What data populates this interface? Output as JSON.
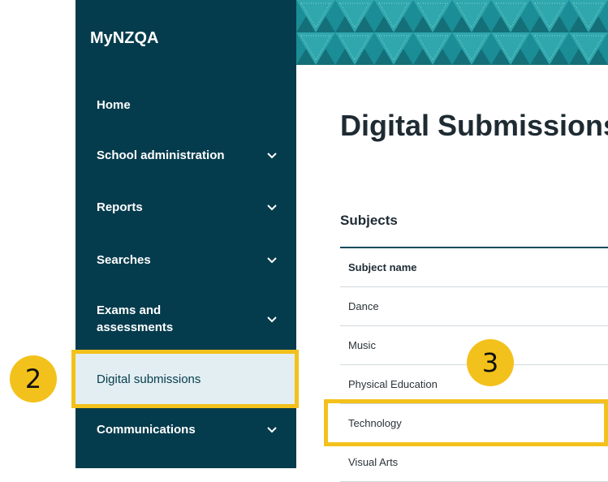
{
  "app": {
    "brand": "MyNZQA"
  },
  "sidebar": {
    "items": [
      {
        "label": "Home",
        "expandable": false
      },
      {
        "label": "School administration",
        "expandable": true
      },
      {
        "label": "Reports",
        "expandable": true
      },
      {
        "label": "Searches",
        "expandable": true
      },
      {
        "label": "Exams and assessments",
        "expandable": true
      },
      {
        "label": "Digital submissions",
        "expandable": false,
        "active": true
      },
      {
        "label": "Communications",
        "expandable": true
      }
    ]
  },
  "main": {
    "title": "Digital Submissions",
    "section_title": "Subjects",
    "table": {
      "header": "Subject name",
      "rows": [
        "Dance",
        "Music",
        "Physical Education",
        "Technology",
        "Visual Arts"
      ]
    }
  },
  "callouts": [
    {
      "number": "2",
      "target": "Digital submissions"
    },
    {
      "number": "3",
      "target": "Technology"
    }
  ],
  "colors": {
    "sidebar_bg": "#053c4d",
    "active_item_bg": "#e2eef2",
    "banner": "#1a8d96",
    "callout": "#f3c11b"
  }
}
